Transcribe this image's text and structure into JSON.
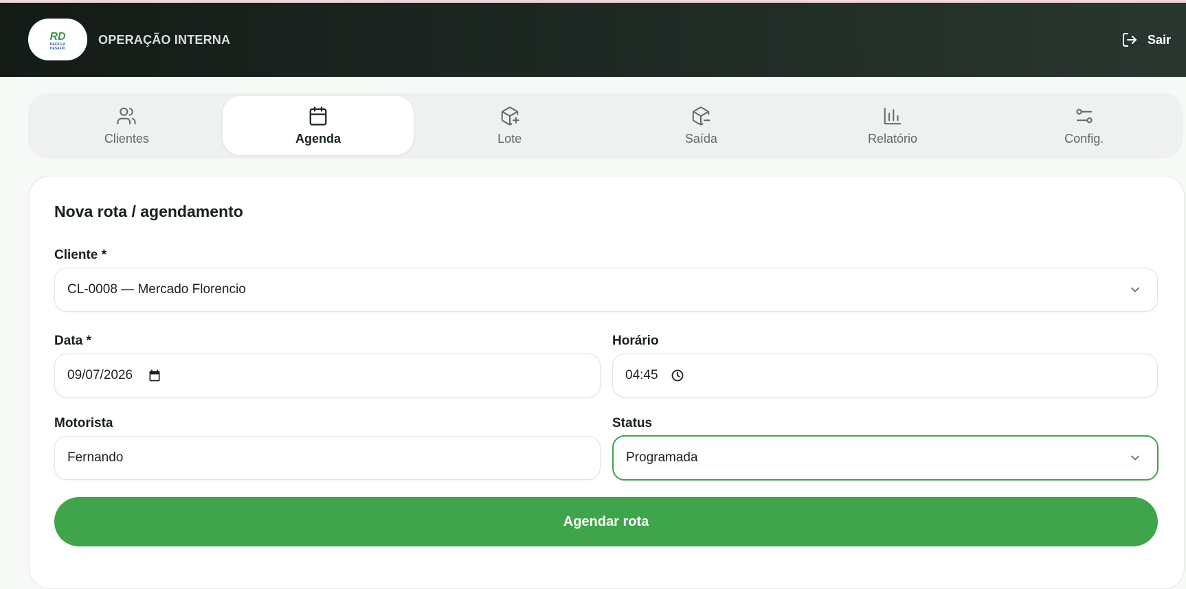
{
  "header": {
    "logo_text_top": "RD",
    "logo_text_mid": "RECICLA",
    "logo_text_bottom": "DESAFIO",
    "title": "OPERAÇÃO INTERNA",
    "logout_label": "Sair"
  },
  "tabs": [
    {
      "label": "Clientes",
      "icon": "users-icon"
    },
    {
      "label": "Agenda",
      "icon": "calendar-icon",
      "active": true
    },
    {
      "label": "Lote",
      "icon": "package-plus-icon"
    },
    {
      "label": "Saída",
      "icon": "package-minus-icon"
    },
    {
      "label": "Relatório",
      "icon": "bar-chart-icon"
    },
    {
      "label": "Config.",
      "icon": "sliders-icon"
    }
  ],
  "form": {
    "title": "Nova rota / agendamento",
    "cliente": {
      "label": "Cliente *",
      "value": "CL-0008 — Mercado Florencio"
    },
    "data": {
      "label": "Data *",
      "value": "09/07/2026"
    },
    "horario": {
      "label": "Horário",
      "value": "04:45"
    },
    "motorista": {
      "label": "Motorista",
      "value": "Fernando"
    },
    "status": {
      "label": "Status",
      "value": "Programada"
    },
    "submit_label": "Agendar rota"
  },
  "colors": {
    "header_dark": "#141b17",
    "accent_green": "#40a54a",
    "tab_bar": "#eef1ef"
  }
}
